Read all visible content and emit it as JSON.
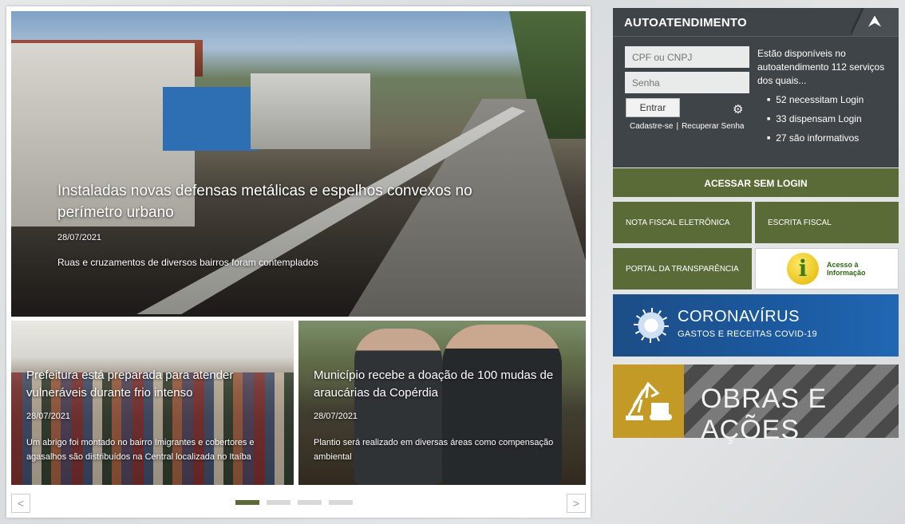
{
  "news": {
    "main": {
      "title": "Instaladas novas defensas metálicas e espelhos convexos no perímetro urbano",
      "date": "28/07/2021",
      "description": "Ruas e cruzamentos de diversos bairros foram contemplados"
    },
    "left": {
      "title": "Prefeitura está preparada para atender vulneráveis durante frio intenso",
      "date": "28/07/2021",
      "description": "Um abrigo foi montado no bairro Imigrantes e cobertores e agasalhos são distribuídos na Central localizada no Itaíba"
    },
    "right": {
      "title": "Município recebe a doação de 100 mudas de araucárias da Copérdia",
      "date": "28/07/2021",
      "description": "Plantio será realizado em diversas áreas como compensação ambiental"
    },
    "pager": {
      "prev": "<",
      "next": ">",
      "pages": 4,
      "active": 1
    }
  },
  "autoatendimento": {
    "title": "AUTOATENDIMENTO",
    "collapse_icon": "double-chevron-up-icon",
    "cpf_placeholder": "CPF ou CNPJ",
    "password_placeholder": "Senha",
    "login_button": "Entrar",
    "register_link": "Cadastre-se",
    "separator": "|",
    "recover_link": "Recuperar Senha",
    "info": "Estão disponíveis no autoatendimento 112 serviços dos quais...",
    "stats": [
      "52 necessitam Login",
      "33 dispensam Login",
      "27 são informativos"
    ]
  },
  "links": {
    "access_without_login": "ACESSAR SEM LOGIN",
    "nota_fiscal": "NOTA FISCAL ELETRÔNICA",
    "escrita_fiscal": "ESCRITA FISCAL",
    "portal_transparencia": "PORTAL DA TRANSPARÊNCIA",
    "acesso_informacao": "Acesso à Informação"
  },
  "covid": {
    "title": "CORONAVÍRUS",
    "subtitle": "GASTOS E RECEITAS COVID-19"
  },
  "obras": {
    "title": "OBRAS E AÇÕES"
  },
  "colors": {
    "accent_green": "#5b6b38",
    "panel_dark": "#3f4448",
    "covid_blue": "#1b5aa0",
    "obras_gold": "#c49a26"
  }
}
